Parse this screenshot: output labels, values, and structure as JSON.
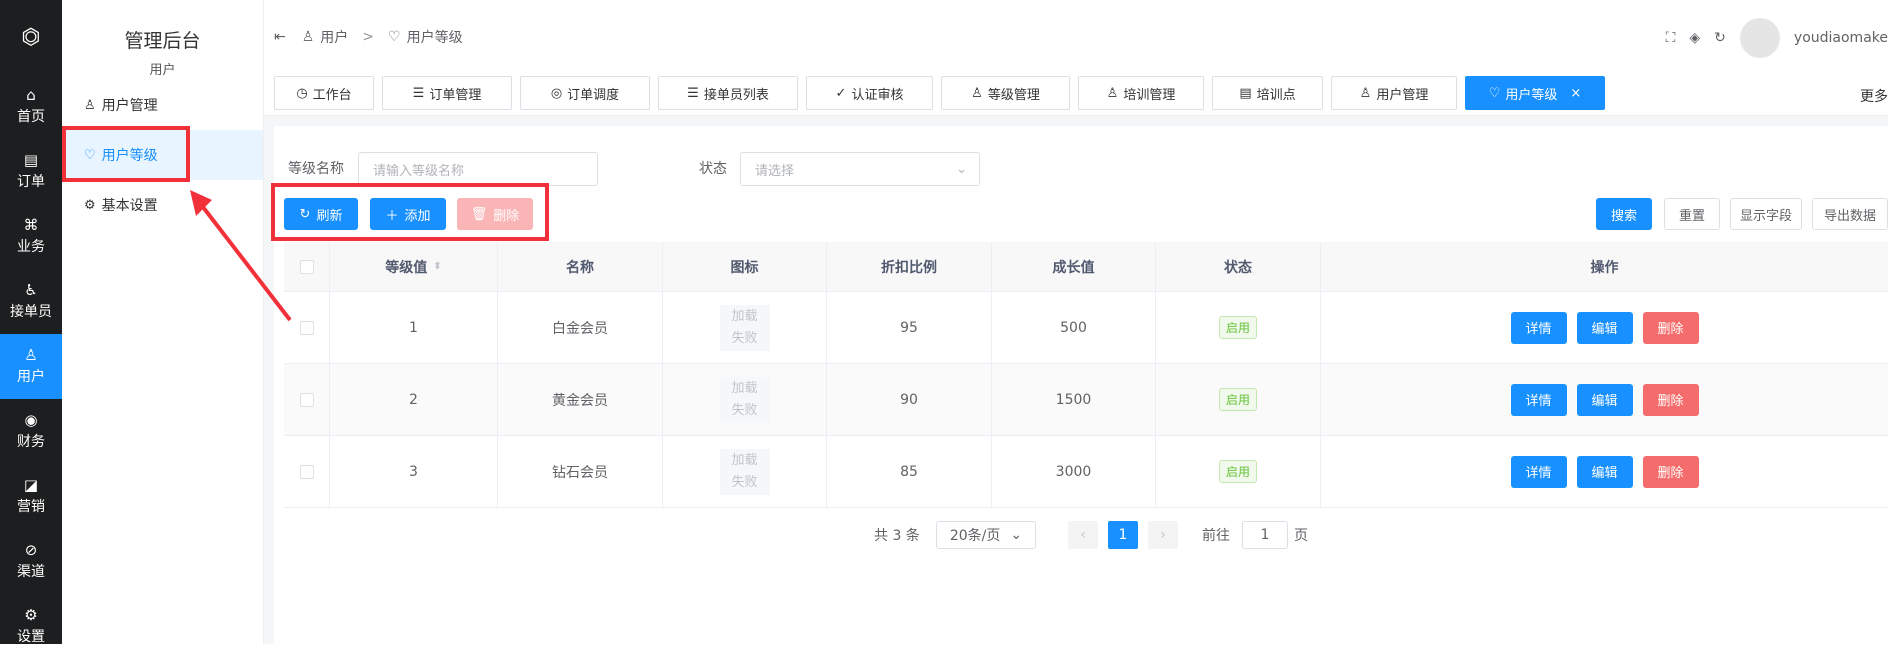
{
  "rail": {
    "logo": "⏣",
    "items": [
      {
        "icon": "home-icon",
        "glyph": "⌂",
        "label": "首页"
      },
      {
        "icon": "order-icon",
        "glyph": "▤",
        "label": "订单"
      },
      {
        "icon": "business-icon",
        "glyph": "⌘",
        "label": "业务"
      },
      {
        "icon": "bike-icon",
        "glyph": "♿",
        "label": "接单员"
      },
      {
        "icon": "user-icon",
        "glyph": "♙",
        "label": "用户"
      },
      {
        "icon": "finance-icon",
        "glyph": "◉",
        "label": "财务"
      },
      {
        "icon": "marketing-icon",
        "glyph": "◪",
        "label": "营销"
      },
      {
        "icon": "channel-icon",
        "glyph": "⊘",
        "label": "渠道"
      },
      {
        "icon": "settings-icon",
        "glyph": "⚙",
        "label": "设置"
      }
    ]
  },
  "sidebar": {
    "title": "管理后台",
    "subtitle": "用户",
    "items": [
      {
        "glyph": "♙",
        "label": "用户管理"
      },
      {
        "glyph": "♡",
        "label": "用户等级"
      },
      {
        "glyph": "⚙",
        "label": "基本设置"
      }
    ]
  },
  "breadcrumb": {
    "toggle": "⇤",
    "first": "用户",
    "sep": ">",
    "second": "用户等级"
  },
  "topbar": {
    "fullscreen": "⛶",
    "skin": "◈",
    "refresh": "↻",
    "username": "youdiaomake"
  },
  "tabs": [
    {
      "glyph": "◷",
      "label": "工作台"
    },
    {
      "glyph": "☰",
      "label": "订单管理"
    },
    {
      "glyph": "◎",
      "label": "订单调度"
    },
    {
      "glyph": "☰",
      "label": "接单员列表"
    },
    {
      "glyph": "✓",
      "label": "认证审核"
    },
    {
      "glyph": "♙",
      "label": "等级管理"
    },
    {
      "glyph": "♙",
      "label": "培训管理"
    },
    {
      "glyph": "▤",
      "label": "培训点"
    },
    {
      "glyph": "♙",
      "label": "用户管理"
    },
    {
      "glyph": "♡",
      "label": "用户等级",
      "close": "×"
    }
  ],
  "more": "更多",
  "filters": {
    "level_name_label": "等级名称",
    "level_name_placeholder": "请输入等级名称",
    "status_label": "状态",
    "status_placeholder": "请选择"
  },
  "actions": {
    "refresh": "刷新",
    "add": "添加",
    "delete": "删除",
    "search": "搜索",
    "reset": "重置",
    "show_fields": "显示字段",
    "export": "导出数据"
  },
  "table": {
    "headers": [
      "等级值",
      "名称",
      "图标",
      "折扣比例",
      "成长值",
      "状态",
      "操作"
    ],
    "rows": [
      {
        "level": "1",
        "name": "白金会员",
        "icon": "加载失败",
        "discount": "95",
        "growth": "500",
        "status": "启用"
      },
      {
        "level": "2",
        "name": "黄金会员",
        "icon": "加载失败",
        "discount": "90",
        "growth": "1500",
        "status": "启用"
      },
      {
        "level": "3",
        "name": "钻石会员",
        "icon": "加载失败",
        "discount": "85",
        "growth": "3000",
        "status": "启用"
      }
    ],
    "op_detail": "详情",
    "op_edit": "编辑",
    "op_delete": "删除"
  },
  "pager": {
    "total": "共 3 条",
    "page_size": "20条/页",
    "current": "1",
    "goto": "前往",
    "goto_value": "1",
    "page_unit": "页"
  },
  "colors": {
    "accent": "#1890ff",
    "danger": "#f56c6c",
    "highlight": "#f2303a",
    "rail_bg": "#1d1e1f"
  }
}
